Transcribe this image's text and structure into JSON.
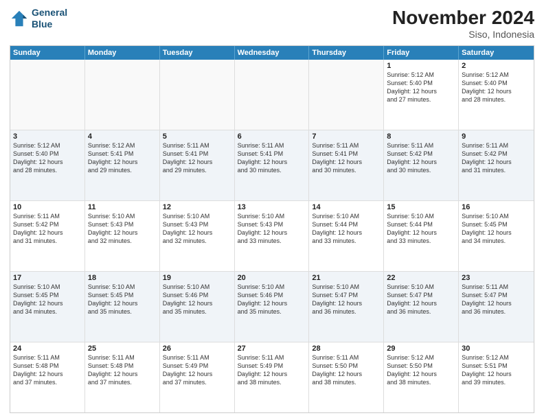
{
  "header": {
    "logo_line1": "General",
    "logo_line2": "Blue",
    "month": "November 2024",
    "location": "Siso, Indonesia"
  },
  "weekdays": [
    "Sunday",
    "Monday",
    "Tuesday",
    "Wednesday",
    "Thursday",
    "Friday",
    "Saturday"
  ],
  "rows": [
    [
      {
        "day": "",
        "info": ""
      },
      {
        "day": "",
        "info": ""
      },
      {
        "day": "",
        "info": ""
      },
      {
        "day": "",
        "info": ""
      },
      {
        "day": "",
        "info": ""
      },
      {
        "day": "1",
        "info": "Sunrise: 5:12 AM\nSunset: 5:40 PM\nDaylight: 12 hours\nand 27 minutes."
      },
      {
        "day": "2",
        "info": "Sunrise: 5:12 AM\nSunset: 5:40 PM\nDaylight: 12 hours\nand 28 minutes."
      }
    ],
    [
      {
        "day": "3",
        "info": "Sunrise: 5:12 AM\nSunset: 5:40 PM\nDaylight: 12 hours\nand 28 minutes."
      },
      {
        "day": "4",
        "info": "Sunrise: 5:12 AM\nSunset: 5:41 PM\nDaylight: 12 hours\nand 29 minutes."
      },
      {
        "day": "5",
        "info": "Sunrise: 5:11 AM\nSunset: 5:41 PM\nDaylight: 12 hours\nand 29 minutes."
      },
      {
        "day": "6",
        "info": "Sunrise: 5:11 AM\nSunset: 5:41 PM\nDaylight: 12 hours\nand 30 minutes."
      },
      {
        "day": "7",
        "info": "Sunrise: 5:11 AM\nSunset: 5:41 PM\nDaylight: 12 hours\nand 30 minutes."
      },
      {
        "day": "8",
        "info": "Sunrise: 5:11 AM\nSunset: 5:42 PM\nDaylight: 12 hours\nand 30 minutes."
      },
      {
        "day": "9",
        "info": "Sunrise: 5:11 AM\nSunset: 5:42 PM\nDaylight: 12 hours\nand 31 minutes."
      }
    ],
    [
      {
        "day": "10",
        "info": "Sunrise: 5:11 AM\nSunset: 5:42 PM\nDaylight: 12 hours\nand 31 minutes."
      },
      {
        "day": "11",
        "info": "Sunrise: 5:10 AM\nSunset: 5:43 PM\nDaylight: 12 hours\nand 32 minutes."
      },
      {
        "day": "12",
        "info": "Sunrise: 5:10 AM\nSunset: 5:43 PM\nDaylight: 12 hours\nand 32 minutes."
      },
      {
        "day": "13",
        "info": "Sunrise: 5:10 AM\nSunset: 5:43 PM\nDaylight: 12 hours\nand 33 minutes."
      },
      {
        "day": "14",
        "info": "Sunrise: 5:10 AM\nSunset: 5:44 PM\nDaylight: 12 hours\nand 33 minutes."
      },
      {
        "day": "15",
        "info": "Sunrise: 5:10 AM\nSunset: 5:44 PM\nDaylight: 12 hours\nand 33 minutes."
      },
      {
        "day": "16",
        "info": "Sunrise: 5:10 AM\nSunset: 5:45 PM\nDaylight: 12 hours\nand 34 minutes."
      }
    ],
    [
      {
        "day": "17",
        "info": "Sunrise: 5:10 AM\nSunset: 5:45 PM\nDaylight: 12 hours\nand 34 minutes."
      },
      {
        "day": "18",
        "info": "Sunrise: 5:10 AM\nSunset: 5:45 PM\nDaylight: 12 hours\nand 35 minutes."
      },
      {
        "day": "19",
        "info": "Sunrise: 5:10 AM\nSunset: 5:46 PM\nDaylight: 12 hours\nand 35 minutes."
      },
      {
        "day": "20",
        "info": "Sunrise: 5:10 AM\nSunset: 5:46 PM\nDaylight: 12 hours\nand 35 minutes."
      },
      {
        "day": "21",
        "info": "Sunrise: 5:10 AM\nSunset: 5:47 PM\nDaylight: 12 hours\nand 36 minutes."
      },
      {
        "day": "22",
        "info": "Sunrise: 5:10 AM\nSunset: 5:47 PM\nDaylight: 12 hours\nand 36 minutes."
      },
      {
        "day": "23",
        "info": "Sunrise: 5:11 AM\nSunset: 5:47 PM\nDaylight: 12 hours\nand 36 minutes."
      }
    ],
    [
      {
        "day": "24",
        "info": "Sunrise: 5:11 AM\nSunset: 5:48 PM\nDaylight: 12 hours\nand 37 minutes."
      },
      {
        "day": "25",
        "info": "Sunrise: 5:11 AM\nSunset: 5:48 PM\nDaylight: 12 hours\nand 37 minutes."
      },
      {
        "day": "26",
        "info": "Sunrise: 5:11 AM\nSunset: 5:49 PM\nDaylight: 12 hours\nand 37 minutes."
      },
      {
        "day": "27",
        "info": "Sunrise: 5:11 AM\nSunset: 5:49 PM\nDaylight: 12 hours\nand 38 minutes."
      },
      {
        "day": "28",
        "info": "Sunrise: 5:11 AM\nSunset: 5:50 PM\nDaylight: 12 hours\nand 38 minutes."
      },
      {
        "day": "29",
        "info": "Sunrise: 5:12 AM\nSunset: 5:50 PM\nDaylight: 12 hours\nand 38 minutes."
      },
      {
        "day": "30",
        "info": "Sunrise: 5:12 AM\nSunset: 5:51 PM\nDaylight: 12 hours\nand 39 minutes."
      }
    ]
  ]
}
